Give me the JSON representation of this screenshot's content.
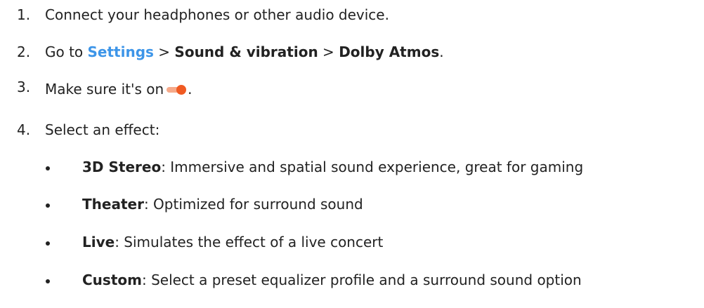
{
  "steps": [
    {
      "number": "1.",
      "text": "Connect your headphones or other audio device."
    },
    {
      "number": "2.",
      "prefix": "Go to ",
      "settings_link": "Settings",
      "sep1": " > ",
      "sound_vibration": "Sound & vibration",
      "sep2": " > ",
      "dolby_atmos": "Dolby Atmos",
      "suffix": "."
    },
    {
      "number": "3.",
      "text": "Make sure it's on",
      "suffix": ".",
      "toggle_state": "on",
      "toggle_color": "#f05a22"
    },
    {
      "number": "4.",
      "text": "Select an effect:"
    }
  ],
  "effects": [
    {
      "name": "3D Stereo",
      "description": ": Immersive and spatial sound experience, great for gaming"
    },
    {
      "name": "Theater",
      "description": ": Optimized for surround sound"
    },
    {
      "name": "Live",
      "description": ": Simulates the effect of a live concert"
    },
    {
      "name": "Custom",
      "description": ": Select a preset equalizer profile and a surround sound option"
    }
  ],
  "colors": {
    "link": "#3d95e8",
    "text": "#222222",
    "toggle_knob": "#f05a22",
    "toggle_track": "#f6aa8a"
  }
}
